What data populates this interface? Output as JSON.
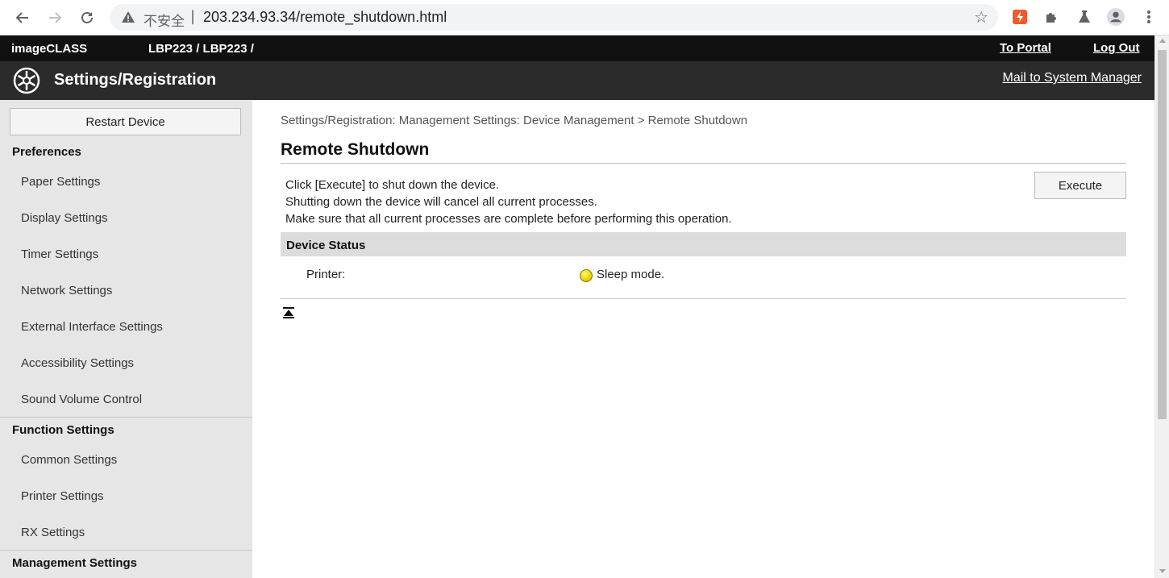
{
  "browser": {
    "back_icon": "back-arrow-icon",
    "forward_icon": "forward-arrow-icon",
    "reload_icon": "reload-icon",
    "security_label": "不安全",
    "security_separator": "|",
    "url": "203.234.93.34/remote_shutdown.html",
    "bookmark_icon": "star-icon",
    "extensions": [
      "lightning-extension-icon",
      "puzzle-extension-icon",
      "flask-icon",
      "profile-avatar-icon",
      "more-menu-icon"
    ]
  },
  "header": {
    "brand": "imageCLASS",
    "model": "LBP223 / LBP223 /",
    "portal_link": "To Portal",
    "logout_link": "Log Out",
    "section_title": "Settings/Registration",
    "mail_link": "Mail to System Manager"
  },
  "sidebar": {
    "restart_label": "Restart Device",
    "groups": [
      {
        "title": "Preferences",
        "items": [
          "Paper Settings",
          "Display Settings",
          "Timer Settings",
          "Network Settings",
          "External Interface Settings",
          "Accessibility Settings",
          "Sound Volume Control"
        ]
      },
      {
        "title": "Function Settings",
        "items": [
          "Common Settings",
          "Printer Settings",
          "RX Settings"
        ]
      },
      {
        "title": "Management Settings",
        "items": []
      }
    ]
  },
  "main": {
    "breadcrumb": "Settings/Registration: Management Settings: Device Management > Remote Shutdown",
    "title": "Remote Shutdown",
    "description": [
      "Click [Execute] to shut down the device.",
      "Shutting down the device will cancel all current processes.",
      "Make sure that all current processes are complete before performing this operation."
    ],
    "execute_label": "Execute",
    "status_heading": "Device Status",
    "printer_label": "Printer:",
    "printer_status": "Sleep mode.",
    "status_color": "#e6cc00"
  },
  "colors": {
    "top_bar": "#111111",
    "title_bar": "#2b2b2b",
    "sidebar": "#e6e6e6",
    "status_head": "#dcdcdc"
  }
}
